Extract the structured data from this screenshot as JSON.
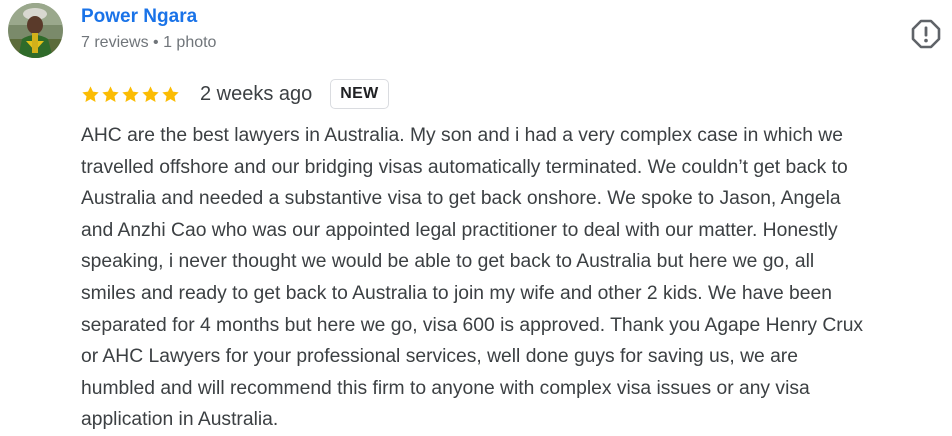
{
  "review": {
    "author": {
      "name": "Power Ngara",
      "meta": "7 reviews • 1 photo",
      "avatar_icon": "profile-photo"
    },
    "report_icon": "report-flag-icon",
    "rating": {
      "stars": 5,
      "max_stars": 5,
      "star_color": "#fbbc04"
    },
    "date": "2 weeks ago",
    "badge": "NEW",
    "text": "AHC are the best lawyers in Australia. My son and i had a very complex case in which we\ntravelled offshore and our bridging visas automatically terminated. We couldn’t get back to\nAustralia and needed a substantive visa to get back onshore. We spoke to Jason, Angela\nand Anzhi Cao who was our appointed legal practitioner to deal with our matter. Honestly\nspeaking, i never thought we would be able to get back to Australia but here we go, all\nsmiles and ready to get back to Australia to join my wife and other 2 kids. We have been\nseparated for 4 months but here we go, visa 600 is approved. Thank you Agape Henry Crux\nor AHC Lawyers for your professional services, well done guys for saving us, we are\nhumbled and will recommend this firm to anyone with complex visa issues or any visa\napplication in Australia."
  },
  "colors": {
    "author_link": "#1a73e8",
    "meta_text": "#70757a",
    "body_text": "#3c4043"
  }
}
